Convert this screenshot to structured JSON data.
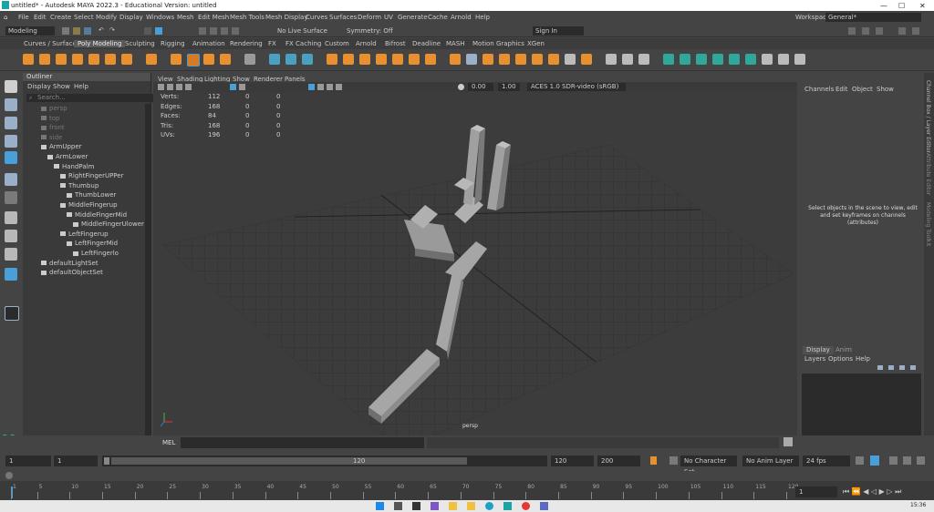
{
  "window": {
    "title": "untitled* - Autodesk MAYA 2022.3 - Educational Version: untitled",
    "min": "—",
    "max": "☐",
    "close": "✕"
  },
  "menubar": {
    "items": [
      "File",
      "Edit",
      "Create",
      "Select",
      "Modify",
      "Display",
      "Windows",
      "Mesh",
      "Edit Mesh",
      "Mesh Tools",
      "Mesh Display",
      "Curves",
      "Surfaces",
      "Deform",
      "UV",
      "Generate",
      "Cache",
      "Arnold",
      "Help"
    ],
    "workspace_label": "Workspace:",
    "workspace_value": "General*"
  },
  "statusline": {
    "mode": "Modeling",
    "live_surface": "No Live Surface",
    "symmetry": "Symmetry: Off",
    "sign_in": "Sign In"
  },
  "shelf": {
    "tabs": [
      "Curves / Surfaces",
      "Poly Modeling",
      "Sculpting",
      "Rigging",
      "Animation",
      "Rendering",
      "FX",
      "FX Caching",
      "Custom",
      "Arnold",
      "Bifrost",
      "Deadline",
      "MASH",
      "Motion Graphics",
      "XGen"
    ],
    "active_tab": 1
  },
  "outliner": {
    "title": "Outliner",
    "menu": [
      "Display",
      "Show",
      "Help"
    ],
    "search_placeholder": "Search...",
    "nodes": [
      {
        "label": "persp",
        "level": 0,
        "dim": true,
        "icon": "camera-icon"
      },
      {
        "label": "top",
        "level": 0,
        "dim": true,
        "icon": "camera-icon"
      },
      {
        "label": "front",
        "level": 0,
        "dim": true,
        "icon": "camera-icon"
      },
      {
        "label": "side",
        "level": 0,
        "dim": true,
        "icon": "camera-icon"
      },
      {
        "label": "ArmUpper",
        "level": 0,
        "dim": false,
        "icon": "joint-icon"
      },
      {
        "label": "ArmLower",
        "level": 1,
        "dim": false,
        "icon": "joint-icon"
      },
      {
        "label": "HandPalm",
        "level": 2,
        "dim": false,
        "icon": "joint-icon"
      },
      {
        "label": "RightFingerUPPer",
        "level": 3,
        "dim": false,
        "icon": "joint-icon"
      },
      {
        "label": "Thumbup",
        "level": 3,
        "dim": false,
        "icon": "joint-icon"
      },
      {
        "label": "ThumbLower",
        "level": 4,
        "dim": false,
        "icon": "joint-icon"
      },
      {
        "label": "MiddleFingerup",
        "level": 3,
        "dim": false,
        "icon": "joint-icon"
      },
      {
        "label": "MiddleFingerMid",
        "level": 4,
        "dim": false,
        "icon": "joint-icon"
      },
      {
        "label": "MiddleFingerUlower",
        "level": 5,
        "dim": false,
        "icon": "joint-icon"
      },
      {
        "label": "LeftFingerup",
        "level": 3,
        "dim": false,
        "icon": "joint-icon"
      },
      {
        "label": "LeftFingerMid",
        "level": 4,
        "dim": false,
        "icon": "joint-icon"
      },
      {
        "label": "LeftFingerlo",
        "level": 5,
        "dim": false,
        "icon": "joint-icon"
      },
      {
        "label": "defaultLightSet",
        "level": 0,
        "dim": false,
        "icon": "set-icon"
      },
      {
        "label": "defaultObjectSet",
        "level": 0,
        "dim": false,
        "icon": "set-icon"
      }
    ]
  },
  "viewport": {
    "menu": [
      "View",
      "Shading",
      "Lighting",
      "Show",
      "Renderer",
      "Panels"
    ],
    "exposure": "0.00",
    "gamma": "1.00",
    "colorspace": "ACES 1.0 SDR-video (sRGB)",
    "camera": "persp",
    "hud": [
      {
        "label": "Verts:",
        "a": "112",
        "b": "0",
        "c": "0"
      },
      {
        "label": "Edges:",
        "a": "168",
        "b": "0",
        "c": "0"
      },
      {
        "label": "Faces:",
        "a": "84",
        "b": "0",
        "c": "0"
      },
      {
        "label": "Tris:",
        "a": "168",
        "b": "0",
        "c": "0"
      },
      {
        "label": "UVs:",
        "a": "196",
        "b": "0",
        "c": "0"
      }
    ]
  },
  "channelbox": {
    "menu": [
      "Channels",
      "Edit",
      "Object",
      "Show"
    ],
    "message": "Select objects in the scene to view, edit and set keyframes on channels (attributes)"
  },
  "layers": {
    "tabs": [
      "Display",
      "Anim"
    ],
    "menu": [
      "Layers",
      "Options",
      "Help"
    ]
  },
  "sidetabs": [
    "Channel Box / Layer Editor",
    "Attribute Editor",
    "Modeling Toolkit"
  ],
  "mel": {
    "label": "MEL"
  },
  "range": {
    "start": "1",
    "current": "1",
    "slider_start": "1",
    "slider_end": "120",
    "end": "120",
    "max": "200",
    "character_set": "No Character Set",
    "anim_layer": "No Anim Layer",
    "fps": "24 fps"
  },
  "timeline": {
    "ticks": [
      "1",
      "5",
      "10",
      "15",
      "20",
      "25",
      "30",
      "35",
      "40",
      "45",
      "50",
      "55",
      "60",
      "65",
      "70",
      "75",
      "80",
      "85",
      "90",
      "95",
      "100",
      "105",
      "110",
      "115",
      "120"
    ],
    "current_frame": "1"
  },
  "taskbar": {
    "time": "15:36"
  },
  "colors": {
    "accent": "#4a9fd8",
    "orange": "#e8902f",
    "teal": "#2fa79b"
  }
}
